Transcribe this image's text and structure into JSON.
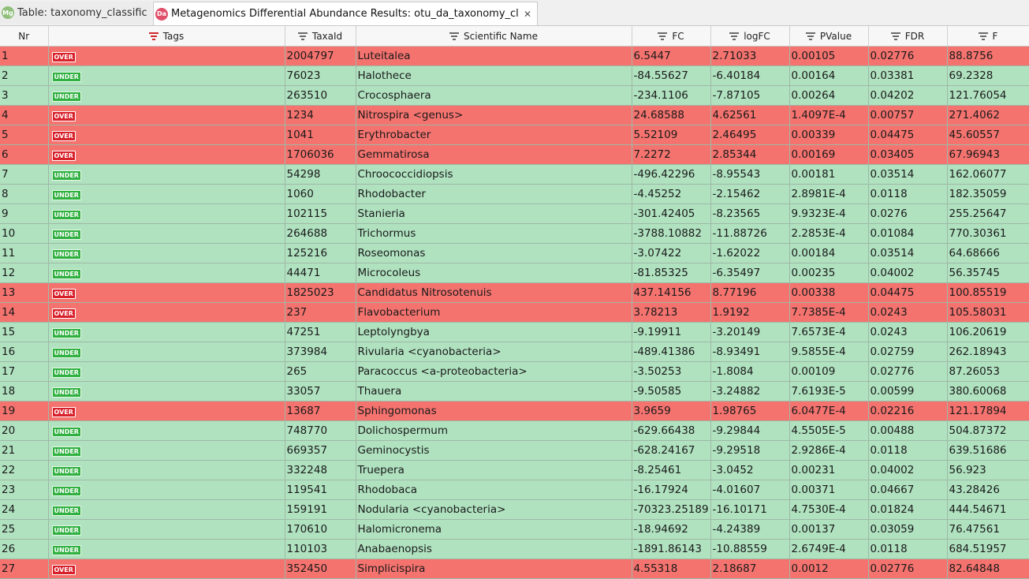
{
  "tabs": [
    {
      "icon": "Mg",
      "label": "Table: taxonomy_classification"
    },
    {
      "icon": "Da",
      "label": "Metagenomics Differential Abundance Results: otu_da_taxonomy_classification"
    }
  ],
  "colors": {
    "over_row": "#f4736f",
    "under_row": "#b0e2c0",
    "over_badge": "#d8202a",
    "under_badge": "#2fb040"
  },
  "columns": [
    "Nr",
    "Tags",
    "TaxaId",
    "Scientific Name",
    "FC",
    "logFC",
    "PValue",
    "FDR",
    "F"
  ],
  "rows": [
    {
      "nr": "1",
      "tag": "OVER",
      "taxa": "2004797",
      "name": "Luteitalea",
      "fc": "6.5447",
      "logfc": "2.71033",
      "p": "0.00105",
      "fdr": "0.02776",
      "f": "88.8756"
    },
    {
      "nr": "2",
      "tag": "UNDER",
      "taxa": "76023",
      "name": "Halothece",
      "fc": "-84.55627",
      "logfc": "-6.40184",
      "p": "0.00164",
      "fdr": "0.03381",
      "f": "69.2328"
    },
    {
      "nr": "3",
      "tag": "UNDER",
      "taxa": "263510",
      "name": "Crocosphaera",
      "fc": "-234.1106",
      "logfc": "-7.87105",
      "p": "0.00264",
      "fdr": "0.04202",
      "f": "121.76054"
    },
    {
      "nr": "4",
      "tag": "OVER",
      "taxa": "1234",
      "name": "Nitrospira <genus>",
      "fc": "24.68588",
      "logfc": "4.62561",
      "p": "1.4097E-4",
      "fdr": "0.00757",
      "f": "271.4062"
    },
    {
      "nr": "5",
      "tag": "OVER",
      "taxa": "1041",
      "name": "Erythrobacter",
      "fc": "5.52109",
      "logfc": "2.46495",
      "p": "0.00339",
      "fdr": "0.04475",
      "f": "45.60557"
    },
    {
      "nr": "6",
      "tag": "OVER",
      "taxa": "1706036",
      "name": "Gemmatirosa",
      "fc": "7.2272",
      "logfc": "2.85344",
      "p": "0.00169",
      "fdr": "0.03405",
      "f": "67.96943"
    },
    {
      "nr": "7",
      "tag": "UNDER",
      "taxa": "54298",
      "name": "Chroococcidiopsis",
      "fc": "-496.42296",
      "logfc": "-8.95543",
      "p": "0.00181",
      "fdr": "0.03514",
      "f": "162.06077"
    },
    {
      "nr": "8",
      "tag": "UNDER",
      "taxa": "1060",
      "name": "Rhodobacter",
      "fc": "-4.45252",
      "logfc": "-2.15462",
      "p": "2.8981E-4",
      "fdr": "0.0118",
      "f": "182.35059"
    },
    {
      "nr": "9",
      "tag": "UNDER",
      "taxa": "102115",
      "name": "Stanieria",
      "fc": "-301.42405",
      "logfc": "-8.23565",
      "p": "9.9323E-4",
      "fdr": "0.0276",
      "f": "255.25647"
    },
    {
      "nr": "10",
      "tag": "UNDER",
      "taxa": "264688",
      "name": "Trichormus",
      "fc": "-3788.10882",
      "logfc": "-11.88726",
      "p": "2.2853E-4",
      "fdr": "0.01084",
      "f": "770.30361"
    },
    {
      "nr": "11",
      "tag": "UNDER",
      "taxa": "125216",
      "name": "Roseomonas",
      "fc": "-3.07422",
      "logfc": "-1.62022",
      "p": "0.00184",
      "fdr": "0.03514",
      "f": "64.68666"
    },
    {
      "nr": "12",
      "tag": "UNDER",
      "taxa": "44471",
      "name": "Microcoleus",
      "fc": "-81.85325",
      "logfc": "-6.35497",
      "p": "0.00235",
      "fdr": "0.04002",
      "f": "56.35745"
    },
    {
      "nr": "13",
      "tag": "OVER",
      "taxa": "1825023",
      "name": "Candidatus Nitrosotenuis",
      "fc": "437.14156",
      "logfc": "8.77196",
      "p": "0.00338",
      "fdr": "0.04475",
      "f": "100.85519"
    },
    {
      "nr": "14",
      "tag": "OVER",
      "taxa": "237",
      "name": "Flavobacterium",
      "fc": "3.78213",
      "logfc": "1.9192",
      "p": "7.7385E-4",
      "fdr": "0.0243",
      "f": "105.58031"
    },
    {
      "nr": "15",
      "tag": "UNDER",
      "taxa": "47251",
      "name": "Leptolyngbya",
      "fc": "-9.19911",
      "logfc": "-3.20149",
      "p": "7.6573E-4",
      "fdr": "0.0243",
      "f": "106.20619"
    },
    {
      "nr": "16",
      "tag": "UNDER",
      "taxa": "373984",
      "name": "Rivularia <cyanobacteria>",
      "fc": "-489.41386",
      "logfc": "-8.93491",
      "p": "9.5855E-4",
      "fdr": "0.02759",
      "f": "262.18943"
    },
    {
      "nr": "17",
      "tag": "UNDER",
      "taxa": "265",
      "name": "Paracoccus <a-proteobacteria>",
      "fc": "-3.50253",
      "logfc": "-1.8084",
      "p": "0.00109",
      "fdr": "0.02776",
      "f": "87.26053"
    },
    {
      "nr": "18",
      "tag": "UNDER",
      "taxa": "33057",
      "name": "Thauera",
      "fc": "-9.50585",
      "logfc": "-3.24882",
      "p": "7.6193E-5",
      "fdr": "0.00599",
      "f": "380.60068"
    },
    {
      "nr": "19",
      "tag": "OVER",
      "taxa": "13687",
      "name": "Sphingomonas",
      "fc": "3.9659",
      "logfc": "1.98765",
      "p": "6.0477E-4",
      "fdr": "0.02216",
      "f": "121.17894"
    },
    {
      "nr": "20",
      "tag": "UNDER",
      "taxa": "748770",
      "name": "Dolichospermum",
      "fc": "-629.66438",
      "logfc": "-9.29844",
      "p": "4.5505E-5",
      "fdr": "0.00488",
      "f": "504.87372"
    },
    {
      "nr": "21",
      "tag": "UNDER",
      "taxa": "669357",
      "name": "Geminocystis",
      "fc": "-628.24167",
      "logfc": "-9.29518",
      "p": "2.9286E-4",
      "fdr": "0.0118",
      "f": "639.51686"
    },
    {
      "nr": "22",
      "tag": "UNDER",
      "taxa": "332248",
      "name": "Truepera",
      "fc": "-8.25461",
      "logfc": "-3.0452",
      "p": "0.00231",
      "fdr": "0.04002",
      "f": "56.923"
    },
    {
      "nr": "23",
      "tag": "UNDER",
      "taxa": "119541",
      "name": "Rhodobaca",
      "fc": "-16.17924",
      "logfc": "-4.01607",
      "p": "0.00371",
      "fdr": "0.04667",
      "f": "43.28426"
    },
    {
      "nr": "24",
      "tag": "UNDER",
      "taxa": "159191",
      "name": "Nodularia <cyanobacteria>",
      "fc": "-70323.25189",
      "logfc": "-16.10171",
      "p": "4.7530E-4",
      "fdr": "0.01824",
      "f": "444.54671"
    },
    {
      "nr": "25",
      "tag": "UNDER",
      "taxa": "170610",
      "name": "Halomicronema",
      "fc": "-18.94692",
      "logfc": "-4.24389",
      "p": "0.00137",
      "fdr": "0.03059",
      "f": "76.47561"
    },
    {
      "nr": "26",
      "tag": "UNDER",
      "taxa": "110103",
      "name": "Anabaenopsis",
      "fc": "-1891.86143",
      "logfc": "-10.88559",
      "p": "2.6749E-4",
      "fdr": "0.0118",
      "f": "684.51957"
    },
    {
      "nr": "27",
      "tag": "OVER",
      "taxa": "352450",
      "name": "Simplicispira",
      "fc": "4.55318",
      "logfc": "2.18687",
      "p": "0.0012",
      "fdr": "0.02776",
      "f": "82.64848"
    }
  ]
}
